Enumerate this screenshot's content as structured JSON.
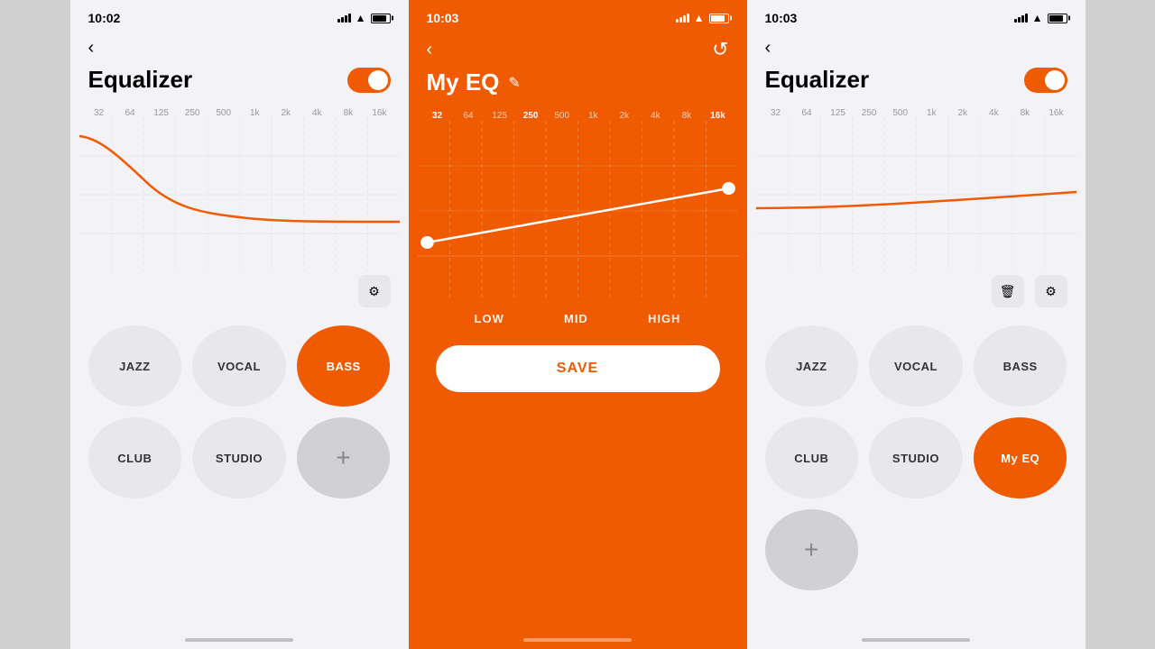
{
  "screens": [
    {
      "id": "screen1",
      "time": "10:02",
      "title": "Equalizer",
      "toggle_on": true,
      "freq_labels": [
        "32",
        "64",
        "125",
        "250",
        "500",
        "1k",
        "2k",
        "4k",
        "8k",
        "16k"
      ],
      "presets": [
        {
          "label": "JAZZ",
          "active": false
        },
        {
          "label": "VOCAL",
          "active": false
        },
        {
          "label": "BASS",
          "active": true
        },
        {
          "label": "CLUB",
          "active": false
        },
        {
          "label": "STUDIO",
          "active": false
        },
        {
          "label": "+",
          "is_add": true
        }
      ],
      "gear_icon": "⚙"
    },
    {
      "id": "screen2",
      "time": "10:03",
      "title": "My EQ",
      "bg": "orange",
      "freq_labels": [
        "32",
        "64",
        "125",
        "250",
        "500",
        "1k",
        "2k",
        "4k",
        "8k",
        "16k"
      ],
      "freq_active": "250",
      "freq_active2": "16k",
      "band_labels": [
        "LOW",
        "MID",
        "HIGH"
      ],
      "save_label": "SAVE",
      "reset_icon": "↺",
      "edit_icon": "✎"
    },
    {
      "id": "screen3",
      "time": "10:03",
      "title": "Equalizer",
      "toggle_on": true,
      "freq_labels": [
        "32",
        "64",
        "125",
        "250",
        "500",
        "1k",
        "2k",
        "4k",
        "8k",
        "16k"
      ],
      "presets": [
        {
          "label": "JAZZ",
          "active": false
        },
        {
          "label": "VOCAL",
          "active": false
        },
        {
          "label": "BASS",
          "active": false
        },
        {
          "label": "CLUB",
          "active": false
        },
        {
          "label": "STUDIO",
          "active": false
        },
        {
          "label": "My EQ",
          "active": true
        }
      ],
      "trash_icon": "🗑",
      "gear_icon": "⚙"
    }
  ]
}
